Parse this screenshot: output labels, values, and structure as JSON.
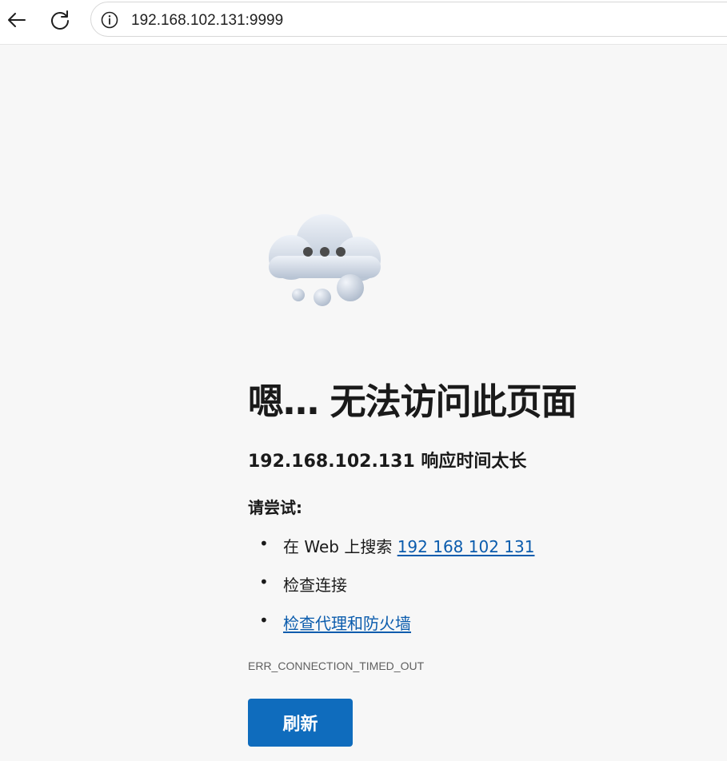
{
  "browser": {
    "url": "192.168.102.131:9999",
    "icons": {
      "back": "back-arrow-icon",
      "refresh": "refresh-icon",
      "site_info": "info-icon"
    }
  },
  "error_page": {
    "illustration": "cloud-icon",
    "title": "嗯… 无法访问此页面",
    "subtitle": "192.168.102.131 响应时间太长",
    "try_heading": "请尝试:",
    "suggestions": [
      {
        "prefix": "在 Web 上搜索 ",
        "link": "192 168 102 131"
      },
      {
        "text": "检查连接"
      },
      {
        "link": "检查代理和防火墙"
      }
    ],
    "error_code": "ERR_CONNECTION_TIMED_OUT",
    "refresh_label": "刷新"
  },
  "colors": {
    "link": "#0b5cad",
    "button": "#0f6cbd",
    "background": "#f7f7f7"
  }
}
